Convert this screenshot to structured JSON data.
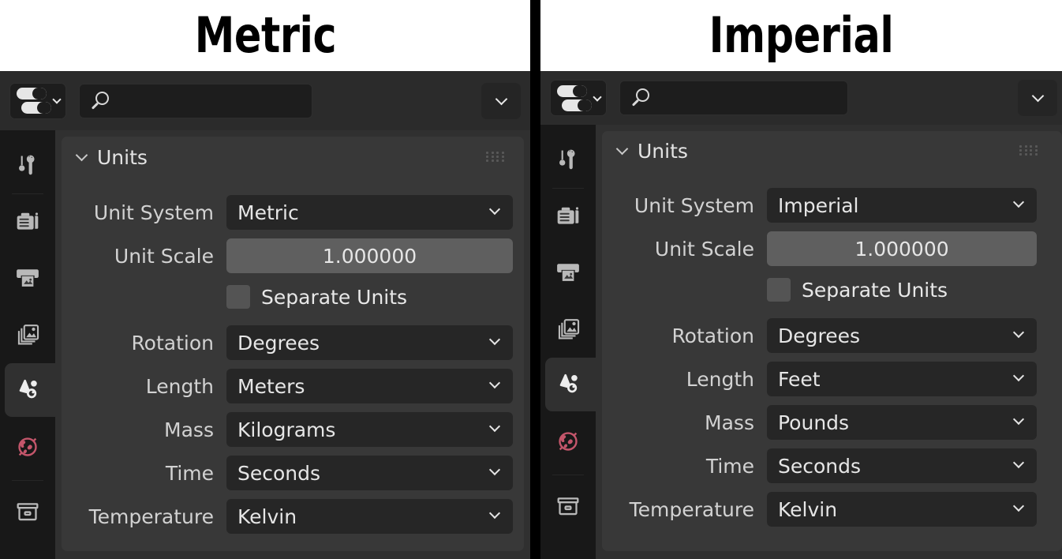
{
  "panels": [
    {
      "title": "Metric",
      "header": {
        "editor_type_icon": "properties-editor-icon",
        "editor_type_chevron_icon": "chevron-down-icon",
        "search_value": "",
        "search_placeholder": "",
        "search_icon": "search-icon",
        "options_chevron_icon": "chevron-down-icon"
      },
      "tabs": [
        {
          "name": "tool",
          "icon": "tool-icon",
          "active": false
        },
        {
          "name": "render",
          "icon": "camera-back-icon",
          "active": false
        },
        {
          "name": "output",
          "icon": "printer-icon",
          "active": false
        },
        {
          "name": "view-layer",
          "icon": "images-icon",
          "active": false
        },
        {
          "name": "scene",
          "icon": "scene-cone-icon",
          "active": true
        },
        {
          "name": "world",
          "icon": "world-globe-icon",
          "active": false
        },
        {
          "name": "collection",
          "icon": "collection-icon",
          "active": false
        }
      ],
      "section": {
        "title": "Units",
        "collapse_icon": "chevron-down-icon",
        "grip_icon": "drag-grip-icon"
      },
      "rows": [
        {
          "label": "Unit System",
          "value": "Metric",
          "type": "dropdown"
        },
        {
          "label": "Unit Scale",
          "value": "1.000000",
          "type": "number"
        },
        {
          "label": "",
          "value": "Separate Units",
          "type": "checkbox",
          "checked": false
        },
        {
          "label": "Rotation",
          "value": "Degrees",
          "type": "dropdown"
        },
        {
          "label": "Length",
          "value": "Meters",
          "type": "dropdown"
        },
        {
          "label": "Mass",
          "value": "Kilograms",
          "type": "dropdown"
        },
        {
          "label": "Time",
          "value": "Seconds",
          "type": "dropdown"
        },
        {
          "label": "Temperature",
          "value": "Kelvin",
          "type": "dropdown"
        }
      ]
    },
    {
      "title": "Imperial",
      "header": {
        "editor_type_icon": "properties-editor-icon",
        "editor_type_chevron_icon": "chevron-down-icon",
        "search_value": "",
        "search_placeholder": "",
        "search_icon": "search-icon",
        "options_chevron_icon": "chevron-down-icon"
      },
      "tabs": [
        {
          "name": "tool",
          "icon": "tool-icon",
          "active": false
        },
        {
          "name": "render",
          "icon": "camera-back-icon",
          "active": false
        },
        {
          "name": "output",
          "icon": "printer-icon",
          "active": false
        },
        {
          "name": "view-layer",
          "icon": "images-icon",
          "active": false
        },
        {
          "name": "scene",
          "icon": "scene-cone-icon",
          "active": true
        },
        {
          "name": "world",
          "icon": "world-globe-icon",
          "active": false
        },
        {
          "name": "collection",
          "icon": "collection-icon",
          "active": false
        }
      ],
      "section": {
        "title": "Units",
        "collapse_icon": "chevron-down-icon",
        "grip_icon": "drag-grip-icon"
      },
      "rows": [
        {
          "label": "Unit System",
          "value": "Imperial",
          "type": "dropdown"
        },
        {
          "label": "Unit Scale",
          "value": "1.000000",
          "type": "number"
        },
        {
          "label": "",
          "value": "Separate Units",
          "type": "checkbox",
          "checked": false
        },
        {
          "label": "Rotation",
          "value": "Degrees",
          "type": "dropdown"
        },
        {
          "label": "Length",
          "value": "Feet",
          "type": "dropdown"
        },
        {
          "label": "Mass",
          "value": "Pounds",
          "type": "dropdown"
        },
        {
          "label": "Time",
          "value": "Seconds",
          "type": "dropdown"
        },
        {
          "label": "Temperature",
          "value": "Kelvin",
          "type": "dropdown"
        }
      ]
    }
  ],
  "colors": {
    "title_bg": "#ffffff",
    "title_fg": "#000000",
    "divider": "#000000",
    "editor_bg": "#181818",
    "header_bg": "#2b2b2b",
    "content_bg": "#303030",
    "card_bg": "#383838",
    "field_bg": "#262626",
    "value_field_bg": "#5f5f5f",
    "text": "#e2e2e2",
    "world_icon": "#c4566b"
  }
}
